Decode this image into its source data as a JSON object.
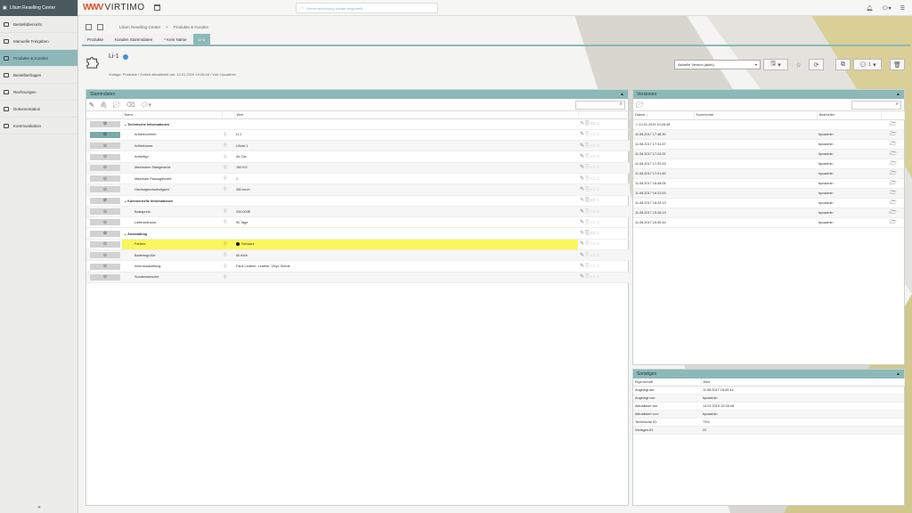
{
  "app": {
    "brand": "Lilium Reselling Center",
    "logo_text": "VIRTIMO",
    "notice": "Serververbindung wiederhergestellt"
  },
  "sidebar": {
    "items": [
      {
        "label": "Bestellübersicht",
        "active": false,
        "icon": "overview-icon"
      },
      {
        "label": "Manuelle Freigaben",
        "active": false,
        "icon": "approval-icon"
      },
      {
        "label": "Produkte & Kunden",
        "active": true,
        "icon": "products-icon"
      },
      {
        "label": "Bestellanfragen",
        "active": false,
        "icon": "request-icon"
      },
      {
        "label": "Rechnungen",
        "active": false,
        "icon": "invoice-icon"
      },
      {
        "label": "Dokumentation",
        "active": false,
        "icon": "docs-icon"
      },
      {
        "label": "Kommunikation",
        "active": false,
        "icon": "chat-icon"
      }
    ],
    "collapse": "«"
  },
  "breadcrumb": [
    "Lilium Reselling Center",
    ">",
    "Produkte & Kunden"
  ],
  "tabs": [
    {
      "label": "Produkte",
      "active": false
    },
    {
      "label": "Kunden Stammdaten",
      "active": false
    },
    {
      "label": "* Kein Name",
      "active": false
    },
    {
      "label": "Li-1",
      "active": true
    }
  ],
  "product": {
    "name": "Li-1",
    "meta": "Vorlage: Produkte  /  Zuletzt aktualisiert am: 14.01.2019 10:28:48  /  Von: bpcadmin",
    "version_select": "Aktuelle Version (aktiv)",
    "comments_count": "1"
  },
  "stammdaten": {
    "title": "Stammdaten",
    "col_name": "Name",
    "col_value": "Wert",
    "rows": [
      {
        "type": "group",
        "name": "Technische Informationen",
        "value": "",
        "icons": "dim"
      },
      {
        "type": "field",
        "name": "Artikelnummer:",
        "value": "Li-1",
        "icons": "normal",
        "active": true
      },
      {
        "type": "field",
        "name": "Artikelname:",
        "value": "Lilium-1",
        "icons": "normal"
      },
      {
        "type": "field",
        "name": "Artikeltyp:",
        "value": "Air Car",
        "icons": "normal"
      },
      {
        "type": "field",
        "name": "Maximales Startgewicht:",
        "value": "150 KG",
        "icons": "normal"
      },
      {
        "type": "field",
        "name": "Maximale Passagierzahl:",
        "value": "1",
        "icons": "normal"
      },
      {
        "type": "field",
        "name": "Höchstgeschwindigkeit:",
        "value": "350 km/h",
        "icons": "normal"
      },
      {
        "type": "group",
        "name": "Kommerzielle Informationen",
        "value": "",
        "icons": "dim"
      },
      {
        "type": "field",
        "name": "Basispreis:",
        "value": "200.000€",
        "icons": "normal"
      },
      {
        "type": "field",
        "name": "Lieferzeitraum:",
        "value": "90 Tage",
        "icons": "normal"
      },
      {
        "type": "group",
        "name": "Ausstattung",
        "value": "",
        "icons": "dim"
      },
      {
        "type": "field",
        "name": "Farben:",
        "value": "Schwarz",
        "icons": "normal",
        "highlight": true
      },
      {
        "type": "field",
        "name": "Batteriegröße:",
        "value": "60 kWh",
        "icons": "normal"
      },
      {
        "type": "field",
        "name": "Innenausstattung:",
        "value": "Faux Leather; Leather; Vinyl; Suede",
        "icons": "normal"
      },
      {
        "type": "field",
        "name": "Sonderwünsche:",
        "value": "",
        "icons": "normal"
      }
    ]
  },
  "versionen": {
    "title": "Versionen",
    "cols": [
      "Datum",
      "Kommentar",
      "Bearbeiter"
    ],
    "rows": [
      {
        "date": "14.01.2019 10:28:48",
        "comment": "",
        "user": "",
        "starred": true
      },
      {
        "date": "11.08.2017 17:48:30",
        "comment": "",
        "user": "bpcadmin"
      },
      {
        "date": "11.08.2017 17:31:57",
        "comment": "",
        "user": "bpcadmin"
      },
      {
        "date": "11.08.2017 17:24:31",
        "comment": "",
        "user": "bpcadmin"
      },
      {
        "date": "11.08.2017 17:20:53",
        "comment": "",
        "user": "bpcadmin"
      },
      {
        "date": "11.08.2017 17:01:46",
        "comment": "",
        "user": "bpcadmin"
      },
      {
        "date": "11.08.2017 16:45:06",
        "comment": "",
        "user": "bpcadmin"
      },
      {
        "date": "11.08.2017 16:31:53",
        "comment": "",
        "user": "bpcadmin"
      },
      {
        "date": "11.08.2017 16:22:13",
        "comment": "",
        "user": "bpcadmin"
      },
      {
        "date": "11.08.2017 15:16:13",
        "comment": "",
        "user": "bpcadmin"
      },
      {
        "date": "11.08.2017 15:40:44",
        "comment": "",
        "user": "bpcadmin"
      }
    ]
  },
  "sonstiges": {
    "title": "Sonstiges",
    "cols": [
      "Eigenschaft",
      "Wert"
    ],
    "rows": [
      {
        "k": "Angelegt am:",
        "v": "11.08.2017 15:40:44"
      },
      {
        "k": "Angelegt von:",
        "v": "bpcadmin"
      },
      {
        "k": "Aktualisiert am:",
        "v": "14.01.2019 10:28:48"
      },
      {
        "k": "Aktualisiert von:",
        "v": "bpcadmin"
      },
      {
        "k": "Technische ID:",
        "v": "73%"
      },
      {
        "k": "Vorlagen-ID:",
        "v": "22"
      }
    ]
  }
}
